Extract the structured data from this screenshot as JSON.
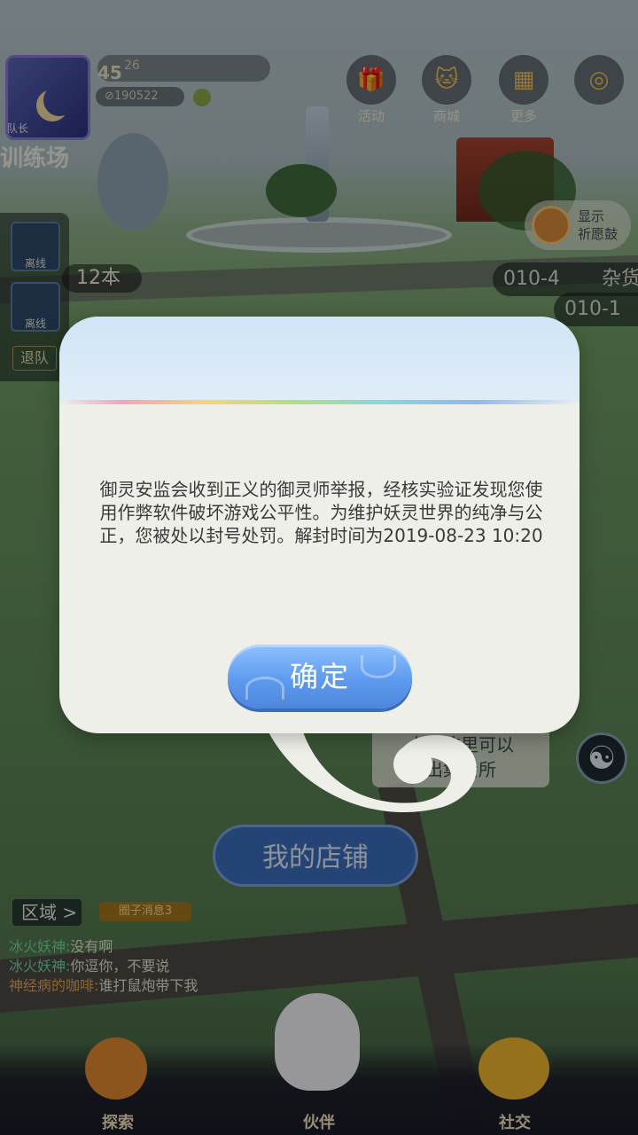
{
  "hud": {
    "team_tag": "队长",
    "level": "45",
    "exp": "26",
    "coins": "190522",
    "location_title": "训练场",
    "buttons": [
      {
        "label": "活动",
        "icon": "gift-icon"
      },
      {
        "label": "商城",
        "icon": "shop-icon"
      },
      {
        "label": "更多",
        "icon": "more-icon"
      },
      {
        "label": "",
        "icon": "compass-icon"
      }
    ]
  },
  "sidebar": {
    "members": [
      {
        "state": "离线"
      },
      {
        "state": "离线"
      }
    ],
    "leave_label": "退队",
    "count_chip": "12本"
  },
  "map": {
    "wish_label_line1": "显示",
    "wish_label_line2": "祈愿鼓",
    "codes": [
      "010-4",
      "杂货",
      "010-1"
    ]
  },
  "dialog": {
    "message": "御灵安监会收到正义的御灵师举报，经核实验证发现您使用作弊软件破坏游戏公平性。为维护妖灵世界的纯净与公正，您被处以封号处罚。解封时间为2019-08-23 10:20",
    "confirm_label": "确定"
  },
  "lower": {
    "hint_line1": "点击这里可以",
    "hint_line2": "出集会所",
    "shop_label": "我的店铺",
    "area_label": "区域 >",
    "circle_msg": "圈子消息3",
    "chat": [
      {
        "who": "冰火妖神:",
        "msg": "没有啊"
      },
      {
        "who": "冰火妖神:",
        "msg": "你逗你，不要说"
      },
      {
        "who": "神经病的咖啡:",
        "msg": "谁打鼠炮带下我"
      }
    ]
  },
  "nav": {
    "items": [
      {
        "label": "探索"
      },
      {
        "label": "伙伴"
      },
      {
        "label": "社交"
      }
    ]
  }
}
